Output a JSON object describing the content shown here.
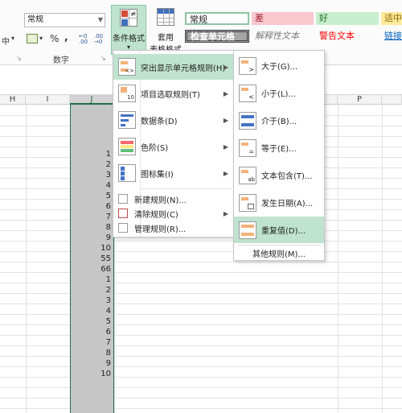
{
  "ribbon": {
    "align_label": "中",
    "number_format_value": "常规",
    "currency_icon": "accounting-format-icon",
    "percent_label": "%",
    "comma_label": ",",
    "inc_decimal_label": "←0 .00",
    "dec_decimal_label": ".00 →0",
    "number_group_label": "数字",
    "cond_format_label": "条件格式",
    "table_format_label_1": "套用",
    "table_format_label_2": "表格格式",
    "styles": [
      {
        "text": "常规"
      },
      {
        "text": "差"
      },
      {
        "text": "好"
      },
      {
        "text": "适中"
      },
      {
        "text": "检查单元格"
      },
      {
        "text": "解释性文本"
      },
      {
        "text": "警告文本"
      },
      {
        "text": "链接"
      }
    ]
  },
  "columns": [
    "H",
    "I",
    "J",
    "P"
  ],
  "cells": [
    "1",
    "2",
    "3",
    "4",
    "5",
    "6",
    "7",
    "8",
    "9",
    "10",
    "55",
    "66",
    "1",
    "2",
    "3",
    "4",
    "5",
    "6",
    "7",
    "8",
    "9",
    "10"
  ],
  "main_menu": {
    "items": [
      {
        "label": "突出显示单元格规则(H)"
      },
      {
        "label": "项目选取规则(T)"
      },
      {
        "label": "数据条(D)"
      },
      {
        "label": "色阶(S)"
      },
      {
        "label": "图标集(I)"
      }
    ],
    "small_items": [
      {
        "label": "新建规则(N)..."
      },
      {
        "label": "清除规则(C)"
      },
      {
        "label": "管理规则(R)..."
      }
    ]
  },
  "sub_menu": {
    "items": [
      {
        "label": "大于(G)..."
      },
      {
        "label": "小于(L)..."
      },
      {
        "label": "介于(B)..."
      },
      {
        "label": "等于(E)..."
      },
      {
        "label": "文本包含(T)..."
      },
      {
        "label": "发生日期(A)..."
      },
      {
        "label": "重复值(D)..."
      }
    ],
    "more_rules": "其他规则(M)..."
  }
}
